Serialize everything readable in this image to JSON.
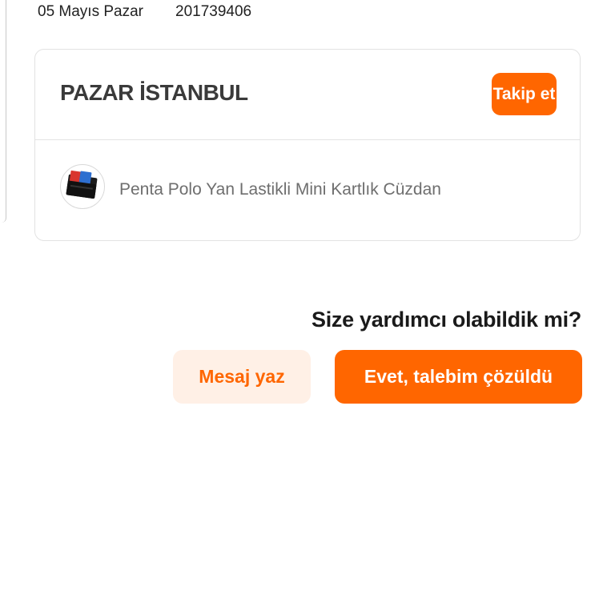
{
  "order": {
    "date": "05 Mayıs Pazar",
    "number": "201739406"
  },
  "store": {
    "name": "PAZAR İSTANBUL",
    "follow_label": "Takip et"
  },
  "product": {
    "name": "Penta Polo Yan Lastikli Mini Kartlık Cüzdan",
    "thumbnail_icon": "wallet-icon"
  },
  "help": {
    "question": "Size yardımcı olabildik mi?",
    "message_label": "Mesaj yaz",
    "resolved_label": "Evet, talebim çözüldü"
  },
  "colors": {
    "accent": "#ff6600",
    "accent_light": "#fff0e6"
  }
}
